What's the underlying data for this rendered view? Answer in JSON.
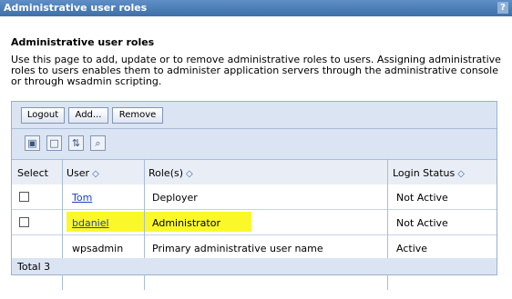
{
  "window": {
    "title": "Administrative user roles",
    "help_label": "?"
  },
  "page": {
    "heading": "Administrative user roles",
    "description": "Use this page to add, update or to remove administrative roles to users. Assigning administrative roles to users enables them to administer application servers through the administrative console or through wsadmin scripting."
  },
  "toolbar": {
    "logout_label": "Logout",
    "add_label": "Add...",
    "remove_label": "Remove"
  },
  "icons": [
    "select-all-icon",
    "deselect-all-icon",
    "show-filter-icon",
    "clear-filter-icon"
  ],
  "table": {
    "columns": {
      "select": "Select",
      "user": "User",
      "roles": "Role(s)",
      "login_status": "Login Status"
    },
    "sort_glyph": "◇",
    "rows": [
      {
        "user": "Tom",
        "roles": "Deployer",
        "login_status": "Not Active",
        "selectable": true,
        "highlighted": false
      },
      {
        "user": "bdaniel",
        "roles": "Administrator",
        "login_status": "Not Active",
        "selectable": true,
        "highlighted": true
      },
      {
        "user": "wpsadmin",
        "roles": "Primary administrative user name",
        "login_status": "Active",
        "selectable": false,
        "highlighted": false
      }
    ],
    "total": "Total 3"
  },
  "colors": {
    "titlebar": "#4a7ab5",
    "panel": "#dbe4f2",
    "highlight": "#fbf82a",
    "link": "#1f3fbf"
  }
}
